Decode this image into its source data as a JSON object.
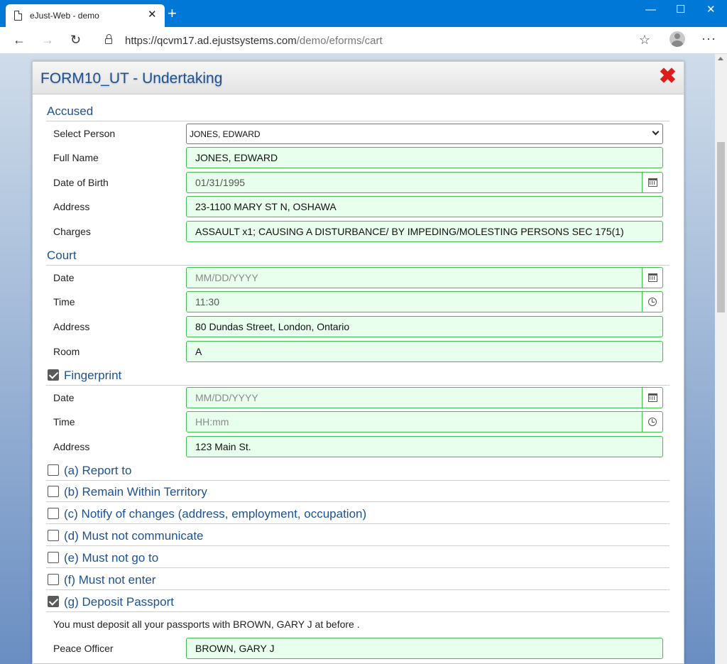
{
  "browser": {
    "tab_title": "eJust-Web - demo",
    "tab_close": "✕",
    "new_tab": "+",
    "minimize": "—",
    "maximize": "☐",
    "close": "✕",
    "back": "←",
    "forward": "→",
    "refresh": "↻",
    "url_host": "https://qcvm17.ad.ejustsystems.com",
    "url_path": "/demo/eforms/cart",
    "more": "···"
  },
  "form": {
    "title": "FORM10_UT - Undertaking",
    "close_glyph": "✖",
    "accused": {
      "label": "Accused",
      "select_person_label": "Select Person",
      "select_person_value": "JONES, EDWARD",
      "full_name_label": "Full Name",
      "full_name": "JONES, EDWARD",
      "dob_label": "Date of Birth",
      "dob": "01/31/1995",
      "address_label": "Address",
      "address": "23-1100 MARY ST N, OSHAWA",
      "charges_label": "Charges",
      "charges": "ASSAULT x1; CAUSING A DISTURBANCE/ BY IMPEDING/MOLESTING PERSONS SEC 175(1)"
    },
    "court": {
      "label": "Court",
      "date_label": "Date",
      "date_placeholder": "MM/DD/YYYY",
      "time_label": "Time",
      "time": "11:30",
      "address_label": "Address",
      "address": "80 Dundas Street, London, Ontario",
      "room_label": "Room",
      "room": "A"
    },
    "fingerprint": {
      "label": "Fingerprint",
      "checked": true,
      "date_label": "Date",
      "date_placeholder": "MM/DD/YYYY",
      "time_label": "Time",
      "time_placeholder": "HH:mm",
      "address_label": "Address",
      "address": "123 Main St."
    },
    "conditions": [
      {
        "label": "(a) Report to",
        "checked": false
      },
      {
        "label": "(b) Remain Within Territory",
        "checked": false
      },
      {
        "label": "(c) Notify of changes (address, employment, occupation)",
        "checked": false
      },
      {
        "label": "(d) Must not communicate",
        "checked": false
      },
      {
        "label": "(e) Must not go to",
        "checked": false
      },
      {
        "label": "(f) Must not enter",
        "checked": false
      },
      {
        "label": "(g) Deposit Passport",
        "checked": true
      }
    ],
    "passport_notice": "You must deposit all your passports with BROWN, GARY J at before .",
    "peace_officer_label": "Peace Officer",
    "peace_officer": "BROWN, GARY J"
  }
}
